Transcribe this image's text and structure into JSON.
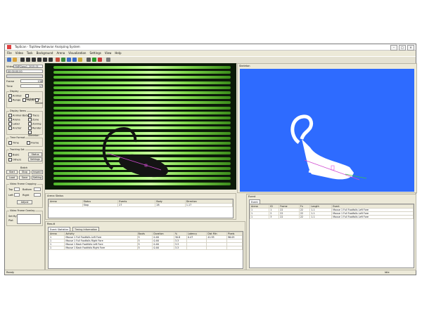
{
  "window": {
    "title": "TopScan - TopView Behavior Analyzing System"
  },
  "menu": [
    "File",
    "Video",
    "Task",
    "Background",
    "Arena",
    "Visualization",
    "Settings",
    "View",
    "Help"
  ],
  "left_panel": {
    "video_label": "Video",
    "video_value": "FMPClass1_2015-01-...",
    "time_value": "00:00:00.00",
    "frame_label": "Frame",
    "frame_value": "138",
    "time_label": "Time",
    "time_value2": "37",
    "display_group": "Display",
    "display_options": [
      "Animal",
      "Background",
      "Range",
      "Tracking",
      "Model"
    ],
    "display_items_group": "Display Items",
    "display_items": [
      "Animal Body",
      "Trace",
      "Arena",
      "Zone",
      "Label",
      "Zoning",
      "Anchor",
      "Render",
      "Skeleton"
    ],
    "time_group": "Time Format",
    "time_options": [
      "Time",
      "Frame"
    ],
    "tracking_group": "Tracking Set",
    "tracking_options": [
      "Basic",
      "Others"
    ],
    "tracking_btns": [
      "Status",
      "Settings"
    ],
    "batch_label": "Batch",
    "batch_buttons": [
      "Start",
      "Stop",
      "Inspect",
      "Load",
      "Save",
      "Setting"
    ],
    "video_crop_group": "Video Frame Cropping",
    "crop_labels": [
      "Top",
      "Bottom",
      "Left",
      "Right"
    ],
    "adjust_btn": "Adjust",
    "overlay_group": "Video Frame Overlay",
    "overlay_labels": [
      "Set By",
      "Plot"
    ]
  },
  "skeleton": {
    "title": "Skeleton"
  },
  "arena_status": {
    "title": "Arena Status",
    "headers": [
      "Arena",
      "Status",
      "Events",
      "Body",
      "Direction"
    ],
    "row": [
      "",
      "Stop",
      "27",
      "28",
      "1.17"
    ]
  },
  "result": {
    "title": "Result",
    "tabs": [
      "Event Statistics",
      "Timing Information"
    ],
    "headers": [
      "Arena",
      "Activity",
      "Bouts",
      "Duration",
      "%",
      "Latency",
      "Dist Min",
      "Pixels"
    ],
    "rows": [
      [
        "1",
        "Mouse 1 Full Footfalls Left Fore",
        "5",
        "0.46",
        "30.8",
        "0.47",
        "41.93",
        "96.05"
      ],
      [
        "1",
        "Mouse 1 Full Footfalls Right Fore",
        "5",
        "0.46",
        "3.3",
        "",
        "",
        ""
      ],
      [
        "1",
        "Mouse 1 Back Footfalls Left Fore",
        "5",
        "0.46",
        "3.3",
        "",
        "",
        ""
      ],
      [
        "1",
        "Mouse 1 Back Footfalls Right Fore",
        "5",
        "0.46",
        "3.3",
        "",
        "",
        ""
      ]
    ]
  },
  "event": {
    "title": "Event",
    "tab": "Event",
    "headers": [
      "Arena",
      "ID",
      "Frame",
      "Fn",
      "Length",
      "Event"
    ],
    "rows": [
      [
        "1",
        "1",
        "22",
        "22",
        "1.1",
        "Mouse 1 Full Footfalls Left Fore"
      ],
      [
        "1",
        "2",
        "22",
        "22",
        "1.1",
        "Mouse 1 Full Footfalls Left Fore"
      ],
      [
        "1",
        "3",
        "22",
        "22",
        "1.1",
        "Mouse 1 Full Footfalls Left Fore"
      ]
    ]
  },
  "status": {
    "left": "Ready",
    "right": "Idle"
  }
}
